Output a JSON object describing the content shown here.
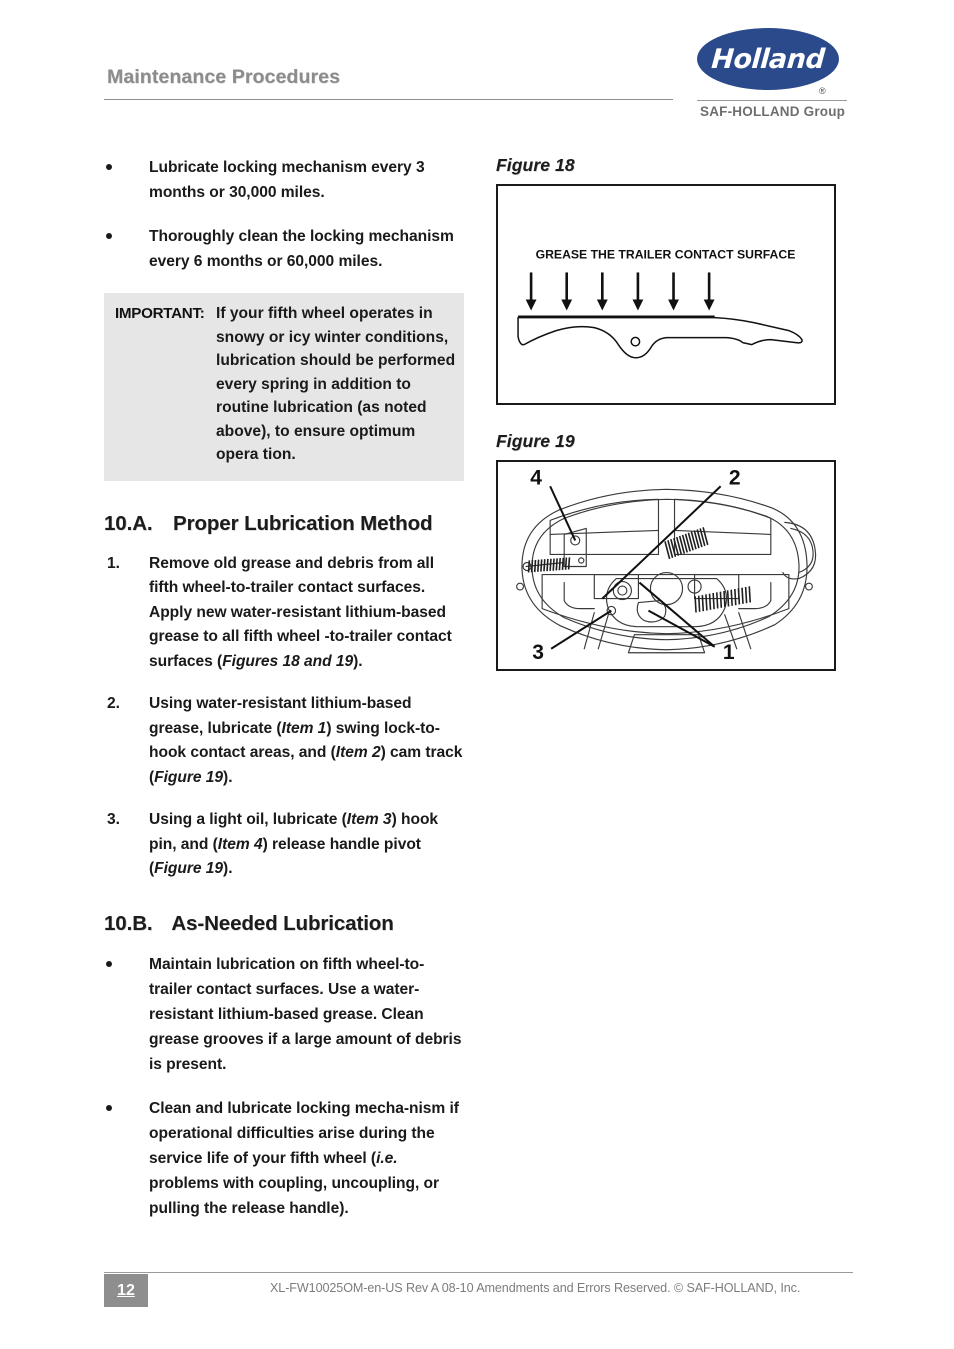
{
  "header": {
    "title": "Maintenance Procedures",
    "logo": {
      "wordmark": "Holland",
      "registered": "®",
      "subtitle": "SAF-HOLLAND Group",
      "brand_color": "#2b4a8b"
    }
  },
  "left_column": {
    "intro_bullets": [
      "Lubricate locking mechanism every 3 months or 30,000 miles.",
      "Thoroughly clean the locking mechanism every 6 months or 60,000 miles."
    ],
    "important_note": {
      "label": "IMPORTANT:",
      "text": "If your fifth wheel operates in snowy or icy winter conditions, lubrication should be performed every spring in addition to routine lubrication (as noted above), to ensure optimum opera tion.",
      "background": "#e6e6e6"
    },
    "section_a": {
      "number": "10.A.",
      "title": "Proper Lubrication Method",
      "steps": [
        {
          "number": "1.",
          "parts": [
            {
              "text": "Remove old grease and debris from all fifth wheel-to-trailer contact surfaces. Apply new water-resistant lithium-based grease to all fifth wheel -to-trailer contact surfaces (",
              "style": "normal"
            },
            {
              "text": "Figures 18 and 19",
              "style": "bold-italic"
            },
            {
              "text": ").",
              "style": "normal"
            }
          ]
        },
        {
          "number": "2.",
          "parts": [
            {
              "text": "Using water-resistant lithium-based grease, lubricate (",
              "style": "normal"
            },
            {
              "text": "Item 1",
              "style": "italic"
            },
            {
              "text": ") swing lock-to-hook contact areas, and (",
              "style": "normal"
            },
            {
              "text": "Item 2",
              "style": "italic"
            },
            {
              "text": ") cam track (",
              "style": "normal"
            },
            {
              "text": "Figure 19",
              "style": "bold-italic"
            },
            {
              "text": ").",
              "style": "normal"
            }
          ]
        },
        {
          "number": "3.",
          "parts": [
            {
              "text": "Using a light oil, lubricate (",
              "style": "normal"
            },
            {
              "text": "Item 3",
              "style": "italic"
            },
            {
              "text": ") hook pin, and (",
              "style": "normal"
            },
            {
              "text": "Item 4",
              "style": "italic"
            },
            {
              "text": ") release handle pivot  (",
              "style": "normal"
            },
            {
              "text": "Figure 19",
              "style": "bold-italic"
            },
            {
              "text": ").",
              "style": "normal"
            }
          ]
        }
      ]
    },
    "section_b": {
      "number": "10.B.",
      "title": "As-Needed Lubrication",
      "bullets": [
        {
          "parts": [
            {
              "text": "Maintain lubrication on fifth wheel-to-trailer contact surfaces. Use a water-resistant lithium-based grease. Clean grease grooves if a large amount of debris is present.",
              "style": "normal"
            }
          ]
        },
        {
          "parts": [
            {
              "text": "Clean and lubricate locking mecha-nism if operational difficulties arise during the service life of your fifth wheel (",
              "style": "normal"
            },
            {
              "text": "i.e.",
              "style": "italic"
            },
            {
              "text": " problems with coupling, uncoupling, or pulling the release handle).",
              "style": "normal"
            }
          ]
        }
      ]
    }
  },
  "figures": [
    {
      "caption": "Figure 18",
      "label": "GREASE THE TRAILER CONTACT SURFACE",
      "arrow_count": 6,
      "description": "side profile of fifth wheel top plate with downward grease arrows"
    },
    {
      "caption": "Figure 19",
      "callouts": [
        "1",
        "2",
        "3",
        "4"
      ],
      "description": "bottom view of fifth wheel locking mechanism with numbered callouts"
    }
  ],
  "footer": {
    "page_number": "12",
    "document_code": "XL-FW10025OM-en-US Rev A   08-10   Amendments and Errors Reserved.   ©  SAF-HOLLAND, Inc."
  }
}
